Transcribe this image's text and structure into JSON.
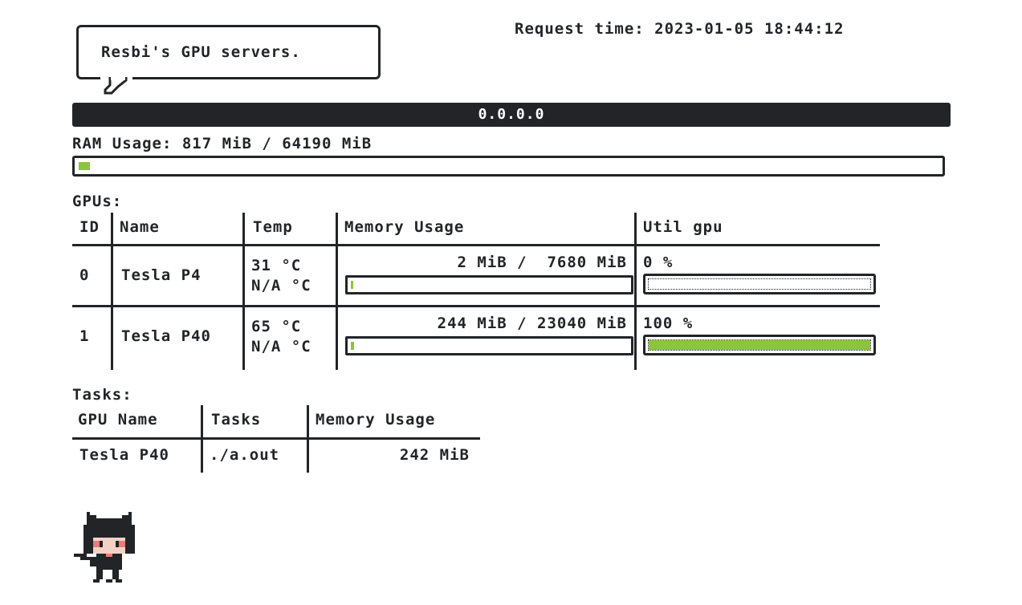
{
  "header": {
    "bubble_text": "Resbi's GPU servers.",
    "request_time": "Request time: 2023-01-05 18:44:12"
  },
  "host": {
    "address": "0.0.0.0"
  },
  "ram": {
    "label": "RAM Usage: 817 MiB / 64190 MiB",
    "used_fraction": 0.0127
  },
  "gpus": {
    "section_label": "GPUs:",
    "columns": {
      "id": "ID",
      "name": "Name",
      "temp": "Temp",
      "memory": "Memory Usage",
      "util": "Util gpu"
    },
    "rows": [
      {
        "id": "0",
        "name": "Tesla P4",
        "temp1": "31 °C",
        "temp2": "N/A °C",
        "memory_text": "2 MiB /  7680 MiB",
        "memory_fraction": 0.0003,
        "util_text": "0 %",
        "util_fraction": 0.0
      },
      {
        "id": "1",
        "name": "Tesla P40",
        "temp1": "65 °C",
        "temp2": "N/A °C",
        "memory_text": "244 MiB / 23040 MiB",
        "memory_fraction": 0.0106,
        "util_text": "100 %",
        "util_fraction": 1.0
      }
    ]
  },
  "tasks": {
    "section_label": "Tasks:",
    "columns": {
      "gpu_name": "GPU Name",
      "tasks": "Tasks",
      "memory": "Memory Usage"
    },
    "rows": [
      {
        "gpu_name": "Tesla P40",
        "task": "./a.out",
        "memory": "242 MiB"
      }
    ]
  },
  "colors": {
    "dark": "#222428",
    "accent": "#8cc43c",
    "background": "#ffffff"
  },
  "mascot": {
    "icon": "pixel-cat-mascot-icon"
  }
}
